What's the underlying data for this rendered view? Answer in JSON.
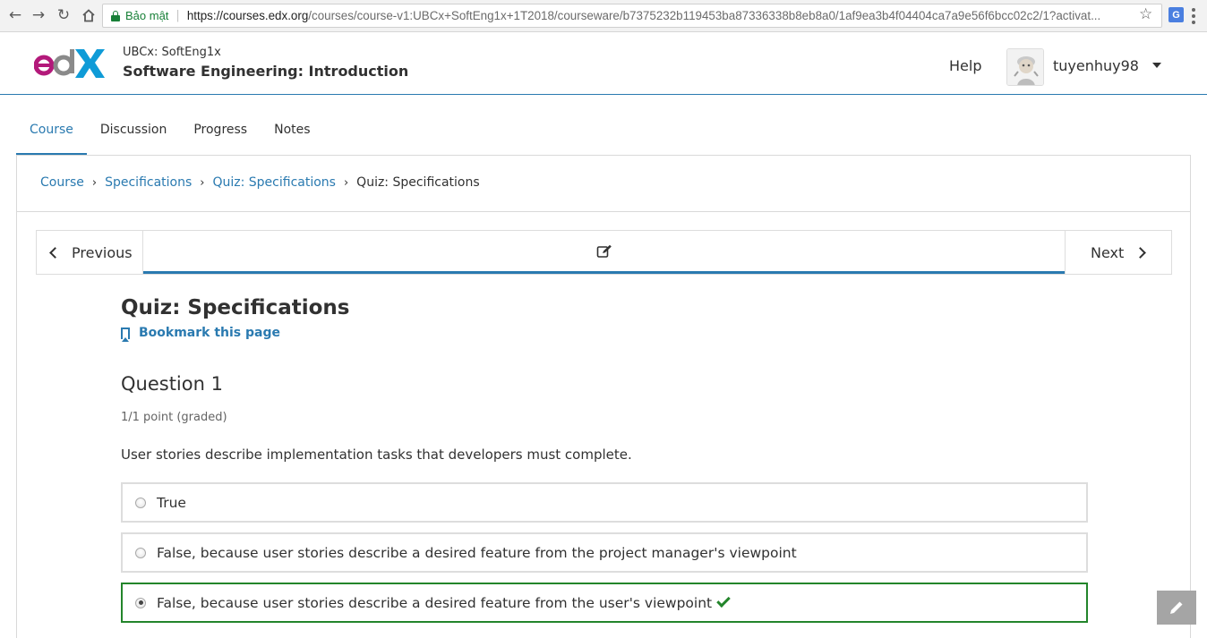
{
  "browser": {
    "secure_label": "Bảo mật",
    "url_host": "https://courses.edx.org",
    "url_path": "/courses/course-v1:UBCx+SoftEng1x+1T2018/courseware/b7375232b119453ba87336338b8eb8a0/1af9ea3b4f04404ca7a9e56f6bcc02c2/1?activat...",
    "extension_label": "G"
  },
  "header": {
    "course_org": "UBCx: SoftEng1x",
    "course_name": "Software Engineering: Introduction",
    "help_label": "Help",
    "username": "tuyenhuy98"
  },
  "tabs": [
    {
      "label": "Course",
      "active": true
    },
    {
      "label": "Discussion",
      "active": false
    },
    {
      "label": "Progress",
      "active": false
    },
    {
      "label": "Notes",
      "active": false
    }
  ],
  "breadcrumb": {
    "items": [
      "Course",
      "Specifications",
      "Quiz: Specifications"
    ],
    "current": "Quiz: Specifications"
  },
  "sequence": {
    "previous_label": "Previous",
    "next_label": "Next"
  },
  "unit": {
    "title": "Quiz: Specifications",
    "bookmark_label": "Bookmark this page"
  },
  "question": {
    "title": "Question 1",
    "points": "1/1 point (graded)",
    "prompt": "User stories describe implementation tasks that developers must complete.",
    "options": [
      {
        "label": "True",
        "selected": false,
        "correct": false
      },
      {
        "label": "False, because user stories describe a desired feature from the project manager's viewpoint",
        "selected": false,
        "correct": false
      },
      {
        "label": "False, because user stories describe a desired feature from the user's viewpoint",
        "selected": true,
        "correct": true
      }
    ]
  },
  "colors": {
    "accent": "#2a7ab0",
    "correct": "#23852b",
    "secure": "#188038"
  }
}
